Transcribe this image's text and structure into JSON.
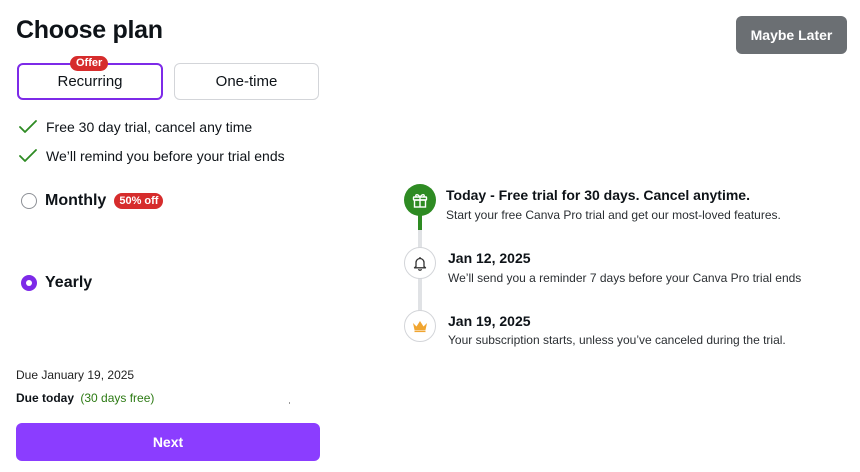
{
  "header": {
    "title": "Choose plan",
    "maybe_later": "Maybe Later"
  },
  "plan_types": {
    "offer_badge": "Offer",
    "recurring": "Recurring",
    "one_time": "One-time",
    "selected": "Recurring"
  },
  "features": [
    "Free 30 day trial, cancel any time",
    "We’ll remind you before your trial ends"
  ],
  "options": {
    "monthly": {
      "label": "Monthly",
      "badge": "50% off",
      "selected": false
    },
    "yearly": {
      "label": "Yearly",
      "selected": true
    }
  },
  "due": {
    "date_text": "Due January 19, 2025",
    "today_label": "Due today",
    "today_free": "(30 days free)"
  },
  "next_button": "Next",
  "timeline": [
    {
      "icon": "gift-icon",
      "title": "Today - Free trial for 30 days. Cancel anytime.",
      "desc": "Start your free Canva Pro trial and get our most-loved features."
    },
    {
      "icon": "bell-icon",
      "title": "Jan 12, 2025",
      "desc": "We’ll send you a reminder 7 days before your Canva Pro trial ends"
    },
    {
      "icon": "crown-icon",
      "title": "Jan 19, 2025",
      "desc": "Your subscription starts, unless you’ve canceled during the trial."
    }
  ],
  "colors": {
    "accent": "#7d2ae8",
    "button": "#8b3dff",
    "success": "#2e8b23",
    "badge": "#d62c2c",
    "secondary_button": "#6b6f73"
  }
}
